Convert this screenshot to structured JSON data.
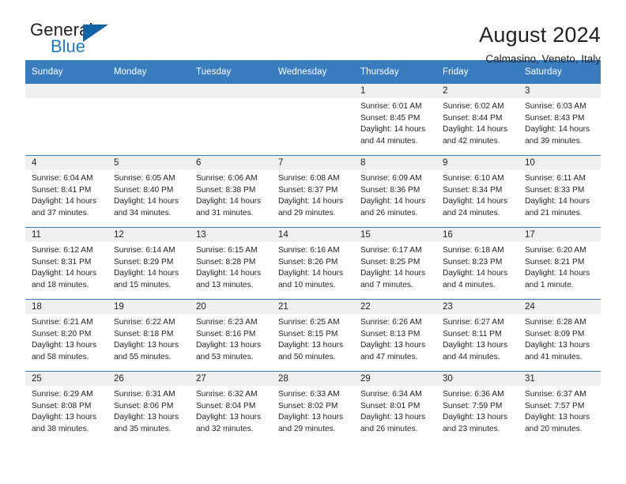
{
  "brand": {
    "line1": "General",
    "line2": "Blue",
    "triangle_color": "#1464a5",
    "blue_text_color": "#1f7bc4"
  },
  "header": {
    "month_title": "August 2024",
    "location": "Calmasino, Veneto, Italy"
  },
  "theme": {
    "header_bar_color": "#3a7dbf",
    "daynum_bar_color": "#efefef",
    "text_color": "#231f20"
  },
  "weekdays": [
    "Sunday",
    "Monday",
    "Tuesday",
    "Wednesday",
    "Thursday",
    "Friday",
    "Saturday"
  ],
  "weeks": [
    [
      {
        "day": "",
        "lines": []
      },
      {
        "day": "",
        "lines": []
      },
      {
        "day": "",
        "lines": []
      },
      {
        "day": "",
        "lines": []
      },
      {
        "day": "1",
        "lines": [
          "Sunrise: 6:01 AM",
          "Sunset: 8:45 PM",
          "Daylight: 14 hours",
          "and 44 minutes."
        ]
      },
      {
        "day": "2",
        "lines": [
          "Sunrise: 6:02 AM",
          "Sunset: 8:44 PM",
          "Daylight: 14 hours",
          "and 42 minutes."
        ]
      },
      {
        "day": "3",
        "lines": [
          "Sunrise: 6:03 AM",
          "Sunset: 8:43 PM",
          "Daylight: 14 hours",
          "and 39 minutes."
        ]
      }
    ],
    [
      {
        "day": "4",
        "lines": [
          "Sunrise: 6:04 AM",
          "Sunset: 8:41 PM",
          "Daylight: 14 hours",
          "and 37 minutes."
        ]
      },
      {
        "day": "5",
        "lines": [
          "Sunrise: 6:05 AM",
          "Sunset: 8:40 PM",
          "Daylight: 14 hours",
          "and 34 minutes."
        ]
      },
      {
        "day": "6",
        "lines": [
          "Sunrise: 6:06 AM",
          "Sunset: 8:38 PM",
          "Daylight: 14 hours",
          "and 31 minutes."
        ]
      },
      {
        "day": "7",
        "lines": [
          "Sunrise: 6:08 AM",
          "Sunset: 8:37 PM",
          "Daylight: 14 hours",
          "and 29 minutes."
        ]
      },
      {
        "day": "8",
        "lines": [
          "Sunrise: 6:09 AM",
          "Sunset: 8:36 PM",
          "Daylight: 14 hours",
          "and 26 minutes."
        ]
      },
      {
        "day": "9",
        "lines": [
          "Sunrise: 6:10 AM",
          "Sunset: 8:34 PM",
          "Daylight: 14 hours",
          "and 24 minutes."
        ]
      },
      {
        "day": "10",
        "lines": [
          "Sunrise: 6:11 AM",
          "Sunset: 8:33 PM",
          "Daylight: 14 hours",
          "and 21 minutes."
        ]
      }
    ],
    [
      {
        "day": "11",
        "lines": [
          "Sunrise: 6:12 AM",
          "Sunset: 8:31 PM",
          "Daylight: 14 hours",
          "and 18 minutes."
        ]
      },
      {
        "day": "12",
        "lines": [
          "Sunrise: 6:14 AM",
          "Sunset: 8:29 PM",
          "Daylight: 14 hours",
          "and 15 minutes."
        ]
      },
      {
        "day": "13",
        "lines": [
          "Sunrise: 6:15 AM",
          "Sunset: 8:28 PM",
          "Daylight: 14 hours",
          "and 13 minutes."
        ]
      },
      {
        "day": "14",
        "lines": [
          "Sunrise: 6:16 AM",
          "Sunset: 8:26 PM",
          "Daylight: 14 hours",
          "and 10 minutes."
        ]
      },
      {
        "day": "15",
        "lines": [
          "Sunrise: 6:17 AM",
          "Sunset: 8:25 PM",
          "Daylight: 14 hours",
          "and 7 minutes."
        ]
      },
      {
        "day": "16",
        "lines": [
          "Sunrise: 6:18 AM",
          "Sunset: 8:23 PM",
          "Daylight: 14 hours",
          "and 4 minutes."
        ]
      },
      {
        "day": "17",
        "lines": [
          "Sunrise: 6:20 AM",
          "Sunset: 8:21 PM",
          "Daylight: 14 hours",
          "and 1 minute."
        ]
      }
    ],
    [
      {
        "day": "18",
        "lines": [
          "Sunrise: 6:21 AM",
          "Sunset: 8:20 PM",
          "Daylight: 13 hours",
          "and 58 minutes."
        ]
      },
      {
        "day": "19",
        "lines": [
          "Sunrise: 6:22 AM",
          "Sunset: 8:18 PM",
          "Daylight: 13 hours",
          "and 55 minutes."
        ]
      },
      {
        "day": "20",
        "lines": [
          "Sunrise: 6:23 AM",
          "Sunset: 8:16 PM",
          "Daylight: 13 hours",
          "and 53 minutes."
        ]
      },
      {
        "day": "21",
        "lines": [
          "Sunrise: 6:25 AM",
          "Sunset: 8:15 PM",
          "Daylight: 13 hours",
          "and 50 minutes."
        ]
      },
      {
        "day": "22",
        "lines": [
          "Sunrise: 6:26 AM",
          "Sunset: 8:13 PM",
          "Daylight: 13 hours",
          "and 47 minutes."
        ]
      },
      {
        "day": "23",
        "lines": [
          "Sunrise: 6:27 AM",
          "Sunset: 8:11 PM",
          "Daylight: 13 hours",
          "and 44 minutes."
        ]
      },
      {
        "day": "24",
        "lines": [
          "Sunrise: 6:28 AM",
          "Sunset: 8:09 PM",
          "Daylight: 13 hours",
          "and 41 minutes."
        ]
      }
    ],
    [
      {
        "day": "25",
        "lines": [
          "Sunrise: 6:29 AM",
          "Sunset: 8:08 PM",
          "Daylight: 13 hours",
          "and 38 minutes."
        ]
      },
      {
        "day": "26",
        "lines": [
          "Sunrise: 6:31 AM",
          "Sunset: 8:06 PM",
          "Daylight: 13 hours",
          "and 35 minutes."
        ]
      },
      {
        "day": "27",
        "lines": [
          "Sunrise: 6:32 AM",
          "Sunset: 8:04 PM",
          "Daylight: 13 hours",
          "and 32 minutes."
        ]
      },
      {
        "day": "28",
        "lines": [
          "Sunrise: 6:33 AM",
          "Sunset: 8:02 PM",
          "Daylight: 13 hours",
          "and 29 minutes."
        ]
      },
      {
        "day": "29",
        "lines": [
          "Sunrise: 6:34 AM",
          "Sunset: 8:01 PM",
          "Daylight: 13 hours",
          "and 26 minutes."
        ]
      },
      {
        "day": "30",
        "lines": [
          "Sunrise: 6:36 AM",
          "Sunset: 7:59 PM",
          "Daylight: 13 hours",
          "and 23 minutes."
        ]
      },
      {
        "day": "31",
        "lines": [
          "Sunrise: 6:37 AM",
          "Sunset: 7:57 PM",
          "Daylight: 13 hours",
          "and 20 minutes."
        ]
      }
    ]
  ]
}
